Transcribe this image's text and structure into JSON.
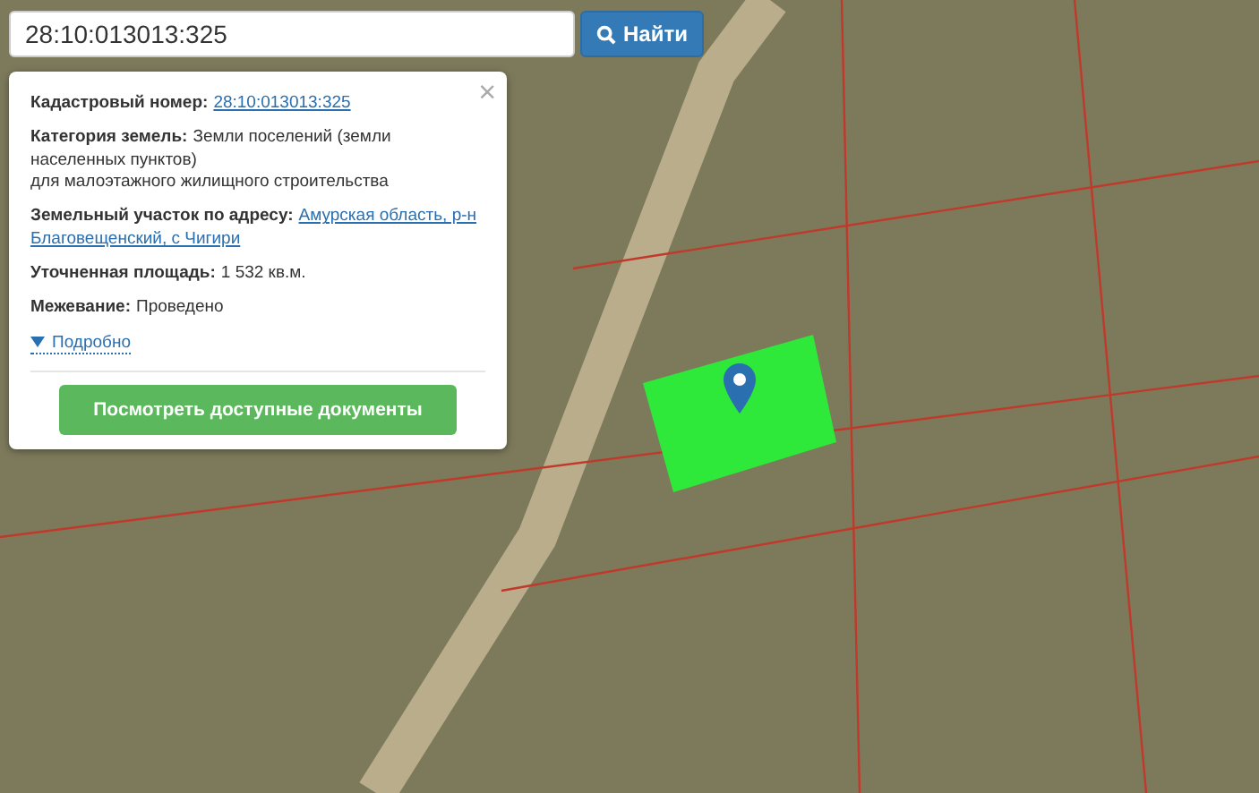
{
  "search": {
    "value": "28:10:013013:325",
    "button": "Найти"
  },
  "popup": {
    "close": "×",
    "fields": [
      {
        "label": "Кадастровый номер:",
        "kind": "link",
        "lines": [
          "28:10:013013:325"
        ]
      },
      {
        "label": "Категория земель:",
        "kind": "text",
        "lines": [
          "Земли поселений (земли",
          "населенных пунктов)",
          "для малоэтажного жилищного строительства"
        ]
      },
      {
        "label": "Земельный участок по адресу:",
        "kind": "link",
        "lines": [
          "Амурская область, р-н",
          "Благовещенский, с Чигири"
        ]
      },
      {
        "label": "Уточненная площадь:",
        "kind": "text",
        "lines": [
          "1 532 кв.м."
        ]
      },
      {
        "label": "Межевание:",
        "kind": "text",
        "lines": [
          "Проведено"
        ]
      }
    ],
    "details": {
      "label": "Подробно",
      "expanded": false
    },
    "action": "Посмотреть доступные документы"
  }
}
